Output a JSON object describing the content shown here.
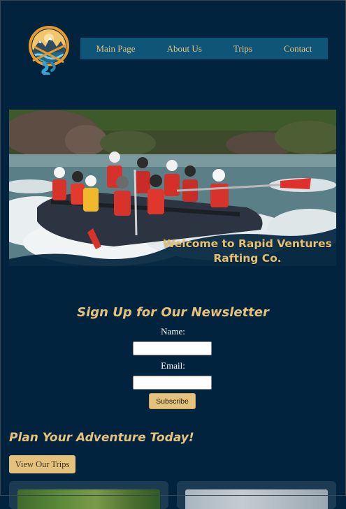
{
  "nav": {
    "items": [
      {
        "label": "Main Page"
      },
      {
        "label": "About Us"
      },
      {
        "label": "Trips"
      },
      {
        "label": "Contact"
      }
    ]
  },
  "hero": {
    "caption": "Welcome to Rapid Ventures Rafting Co."
  },
  "newsletter": {
    "title": "Sign Up for Our Newsletter",
    "name_label": "Name:",
    "name_value": "",
    "email_label": "Email:",
    "email_value": "",
    "submit_label": "Subscribe"
  },
  "plan": {
    "title": "Plan Your Adventure Today!",
    "button_label": "View Our Trips"
  },
  "colors": {
    "background": "#01233d",
    "accent": "#e5c27b",
    "nav_background": "#0f5577",
    "card_background": "#1c3a52"
  },
  "icons": {
    "logo": "mountain-river-kayak-logo"
  }
}
